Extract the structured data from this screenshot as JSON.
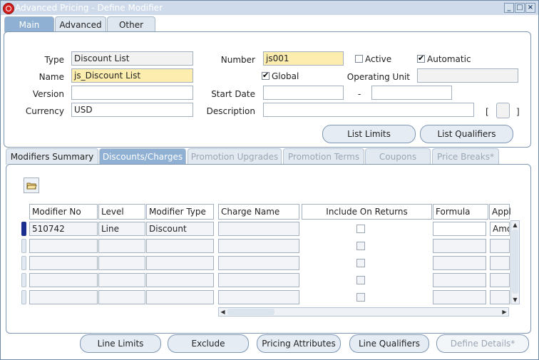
{
  "window": {
    "title": "Advanced Pricing - Define Modifier"
  },
  "top_tabs": [
    {
      "label": "Main",
      "selected": true
    },
    {
      "label": "Advanced",
      "selected": false
    },
    {
      "label": "Other",
      "selected": false
    }
  ],
  "header": {
    "type_label": "Type",
    "type_value": "Discount List",
    "name_label": "Name",
    "name_value": "js_Discount List",
    "version_label": "Version",
    "version_value": "",
    "currency_label": "Currency",
    "currency_value": "USD",
    "number_label": "Number",
    "number_value": "js001",
    "start_date_label": "Start Date",
    "start_date_value": "",
    "date_sep": "-",
    "end_date_value": "",
    "description_label": "Description",
    "description_value": "",
    "active_label": "Active",
    "active_checked": false,
    "automatic_label": "Automatic",
    "automatic_checked": true,
    "global_label": "Global",
    "global_checked": true,
    "operating_unit_label": "Operating Unit",
    "operating_unit_value": "",
    "bracket_open": "[",
    "bracket_close": "]"
  },
  "header_buttons": {
    "list_limits": "List Limits",
    "list_qualifiers": "List Qualifiers"
  },
  "bottom_tabs": [
    {
      "label": "Modifiers Summary",
      "enabled": true
    },
    {
      "label": "Discounts/Charges",
      "enabled": true,
      "selected": true
    },
    {
      "label": "Promotion Upgrades",
      "enabled": false
    },
    {
      "label": "Promotion Terms",
      "enabled": false
    },
    {
      "label": "Coupons",
      "enabled": false
    },
    {
      "label": "Price Breaks*",
      "enabled": false
    }
  ],
  "grid": {
    "columns": [
      "Modifier No",
      "Level",
      "Modifier Type",
      "Charge Name",
      "Include On Returns",
      "Formula",
      "Appl"
    ],
    "rows": [
      {
        "modifier_no": "510742",
        "level": "Line",
        "modifier_type": "Discount",
        "charge_name": "",
        "formula": "",
        "appl": "Amo"
      },
      {
        "modifier_no": "",
        "level": "",
        "modifier_type": "",
        "charge_name": "",
        "formula": "",
        "appl": ""
      },
      {
        "modifier_no": "",
        "level": "",
        "modifier_type": "",
        "charge_name": "",
        "formula": "",
        "appl": ""
      },
      {
        "modifier_no": "",
        "level": "",
        "modifier_type": "",
        "charge_name": "",
        "formula": "",
        "appl": ""
      },
      {
        "modifier_no": "",
        "level": "",
        "modifier_type": "",
        "charge_name": "",
        "formula": "",
        "appl": ""
      }
    ]
  },
  "footer_buttons": {
    "line_limits": "Line Limits",
    "exclude": "Exclude",
    "pricing_attributes": "Pricing Attributes",
    "line_qualifiers": "Line Qualifiers",
    "define_details": "Define Details*"
  },
  "colors": {
    "accent": "#8fb0d3",
    "required_field": "#fdeeb0",
    "title_bar": "#cfdbea"
  }
}
